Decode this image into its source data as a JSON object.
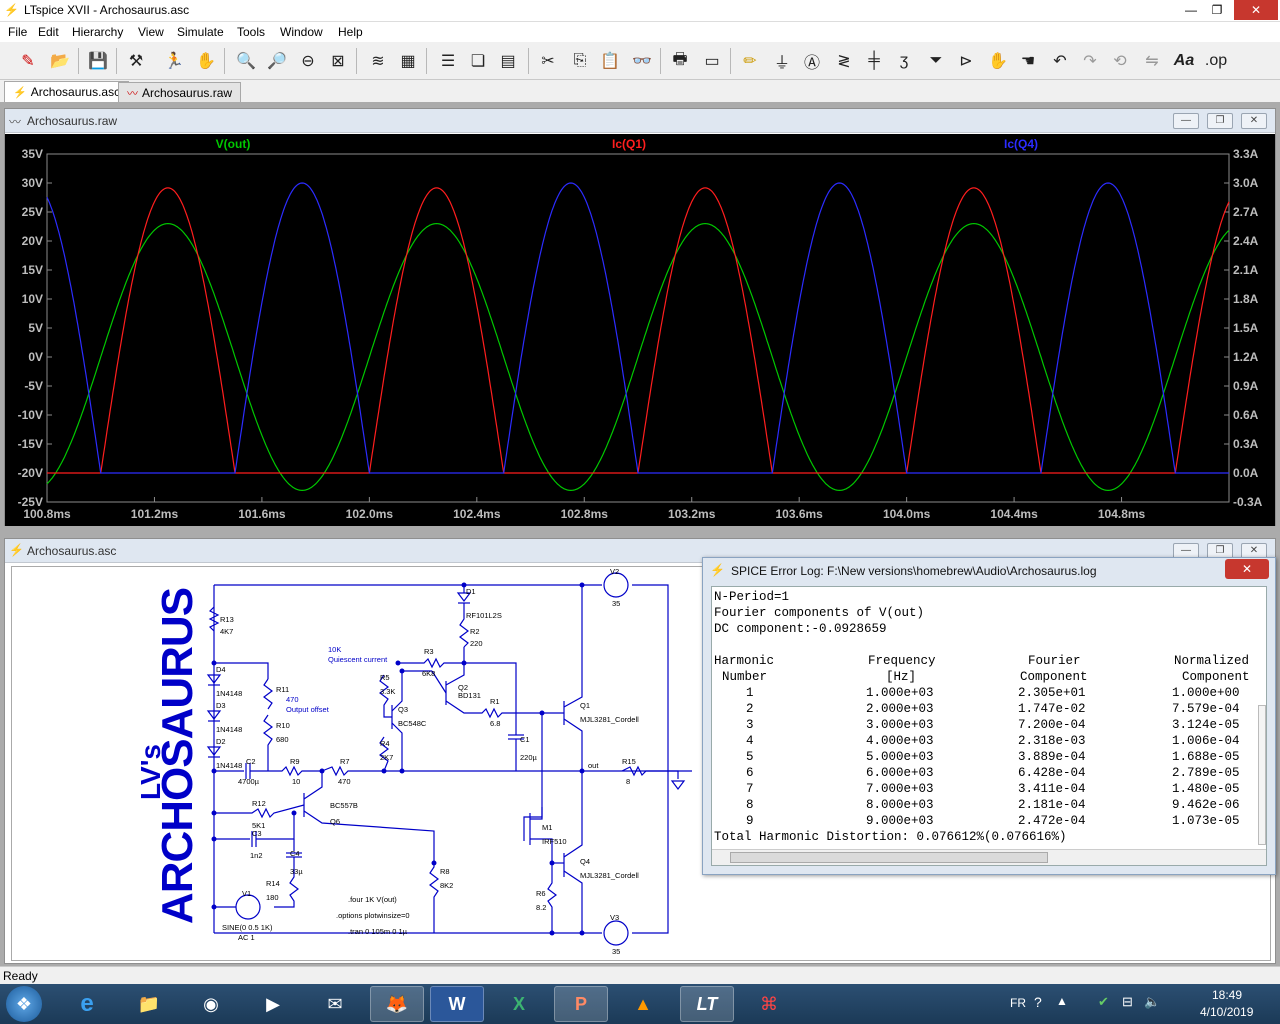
{
  "window": {
    "title": "LTspice XVII - Archosaurus.asc"
  },
  "menu": [
    "File",
    "Edit",
    "Hierarchy",
    "View",
    "Simulate",
    "Tools",
    "Window",
    "Help"
  ],
  "tabs": [
    {
      "label": "Archosaurus.asc",
      "active": true
    },
    {
      "label": "Archosaurus.raw",
      "active": false
    }
  ],
  "waveform_pane": {
    "title": "Archosaurus.raw",
    "traces": [
      {
        "name": "V(out)",
        "color": "#00c800"
      },
      {
        "name": "Ic(Q1)",
        "color": "#ff1e1e"
      },
      {
        "name": "Ic(Q4)",
        "color": "#2c2cff"
      }
    ]
  },
  "chart_data": {
    "type": "line",
    "title": "",
    "x": {
      "label": "",
      "range": [
        100.8,
        105.2
      ],
      "ticks": [
        "100.8ms",
        "101.2ms",
        "101.6ms",
        "102.0ms",
        "102.4ms",
        "102.8ms",
        "103.2ms",
        "103.6ms",
        "104.0ms",
        "104.4ms",
        "104.8ms"
      ]
    },
    "y_left": {
      "range": [
        -25,
        35
      ],
      "ticks": [
        "35V",
        "30V",
        "25V",
        "20V",
        "15V",
        "10V",
        "5V",
        "0V",
        "-5V",
        "-10V",
        "-15V",
        "-20V",
        "-25V"
      ]
    },
    "y_right": {
      "range": [
        -0.3,
        3.3
      ],
      "ticks": [
        "3.3A",
        "3.0A",
        "2.7A",
        "2.4A",
        "2.1A",
        "1.8A",
        "1.5A",
        "1.2A",
        "0.9A",
        "0.6A",
        "0.3A",
        "0.0A",
        "-0.3A"
      ]
    },
    "series": [
      {
        "name": "V(out)",
        "axis": "left",
        "shape": "sine",
        "offset": 0,
        "amplitude": 23,
        "frequency_khz": 1,
        "peak_at_ms": 101.25
      },
      {
        "name": "Ic(Q1)",
        "axis": "right",
        "shape": "class-ab",
        "idle": 0.0,
        "peak": 2.95,
        "frequency_khz": 1,
        "peak_at_ms": 101.25
      },
      {
        "name": "Ic(Q4)",
        "axis": "right",
        "shape": "class-ab",
        "idle": 0.0,
        "peak": 3.0,
        "frequency_khz": 1,
        "peak_at_ms": 101.75
      }
    ],
    "grid": false,
    "background": "#000000"
  },
  "schematic_pane": {
    "title": "Archosaurus.asc",
    "banner_big": "ARCHOSAURUS",
    "banner_small": "LV's",
    "labels": {
      "r13": "R13",
      "r13v": "4K7",
      "d4": "D4",
      "d4v": "1N4148",
      "d3": "D3",
      "d3v": "1N4148",
      "d2": "D2",
      "d2v": "1N4148",
      "r11": "R11",
      "r11v": "470",
      "off": "Output offset",
      "r10": "R10",
      "r10v": "680",
      "c2": "C2",
      "c2v": "4700µ",
      "r9": "R9",
      "r9v": "10",
      "r7": "R7",
      "r7v": "470",
      "r12": "R12",
      "r12v": "5K1",
      "c3": "C3",
      "c3v": "1n2",
      "c4": "C4",
      "c4v": "33µ",
      "r14": "R14",
      "r14v": "180",
      "v1": "V1",
      "v1v": "SINE(0 0.5 1K)",
      "v1ac": "AC 1",
      "q6m": "BC557B",
      "q6": "Q6",
      "r8": "R8",
      "r8v": "8K2",
      "quies1": "10K",
      "quies2": "Quiescent current",
      "r5": "R5",
      "r5v": "3.3K",
      "q3": "Q3",
      "q3m": "BC548C",
      "r4": "R4",
      "r4v": "2K7",
      "r3": "R3",
      "r3v": "6K8",
      "q2": "Q2",
      "q2m": "BD131",
      "d1": "D1",
      "d1m": "RF101L2S",
      "r2": "R2",
      "r2v": "220",
      "r1": "R1",
      "r1v": "6.8",
      "c1": "C1",
      "c1v": "220µ",
      "q1": "Q1",
      "q1m": "MJL3281_Cordell",
      "m1": "M1",
      "m1m": "IRF510",
      "q4": "Q4",
      "q4m": "MJL3281_Cordell",
      "r6": "R6",
      "r6v": "8.2",
      "out": "out",
      "r15": "R15",
      "r15v": "8",
      "v2": "V2",
      "v2v": "35",
      "v3": "V3",
      "v3v": "35",
      "dir1": ".four 1K V(out)",
      "dir2": ".options plotwinsize=0",
      "dir3": ".tran 0 105m 0 1µ"
    }
  },
  "error_log": {
    "title": "SPICE Error Log: F:\\New versions\\homebrew\\Audio\\Archosaurus.log",
    "line1": "N-Period=1",
    "line2": "Fourier components of V(out)",
    "line3": "DC component:-0.0928659",
    "headers1": [
      "Harmonic",
      "Frequency",
      "Fourier",
      "Normalized"
    ],
    "headers2": [
      "Number",
      "[Hz]",
      "Component",
      "Component"
    ],
    "rows": [
      [
        "1",
        "1.000e+03",
        "2.305e+01",
        "1.000e+00"
      ],
      [
        "2",
        "2.000e+03",
        "1.747e-02",
        "7.579e-04"
      ],
      [
        "3",
        "3.000e+03",
        "7.200e-04",
        "3.124e-05"
      ],
      [
        "4",
        "4.000e+03",
        "2.318e-03",
        "1.006e-04"
      ],
      [
        "5",
        "5.000e+03",
        "3.889e-04",
        "1.688e-05"
      ],
      [
        "6",
        "6.000e+03",
        "6.428e-04",
        "2.789e-05"
      ],
      [
        "7",
        "7.000e+03",
        "3.411e-04",
        "1.480e-05"
      ],
      [
        "8",
        "8.000e+03",
        "2.181e-04",
        "9.462e-06"
      ],
      [
        "9",
        "9.000e+03",
        "2.472e-04",
        "1.073e-05"
      ]
    ],
    "thd": "Total Harmonic Distortion: 0.076612%(0.076616%)"
  },
  "status": {
    "text": "Ready"
  },
  "tray": {
    "lang": "FR",
    "time": "18:49",
    "date": "4/10/2019"
  }
}
